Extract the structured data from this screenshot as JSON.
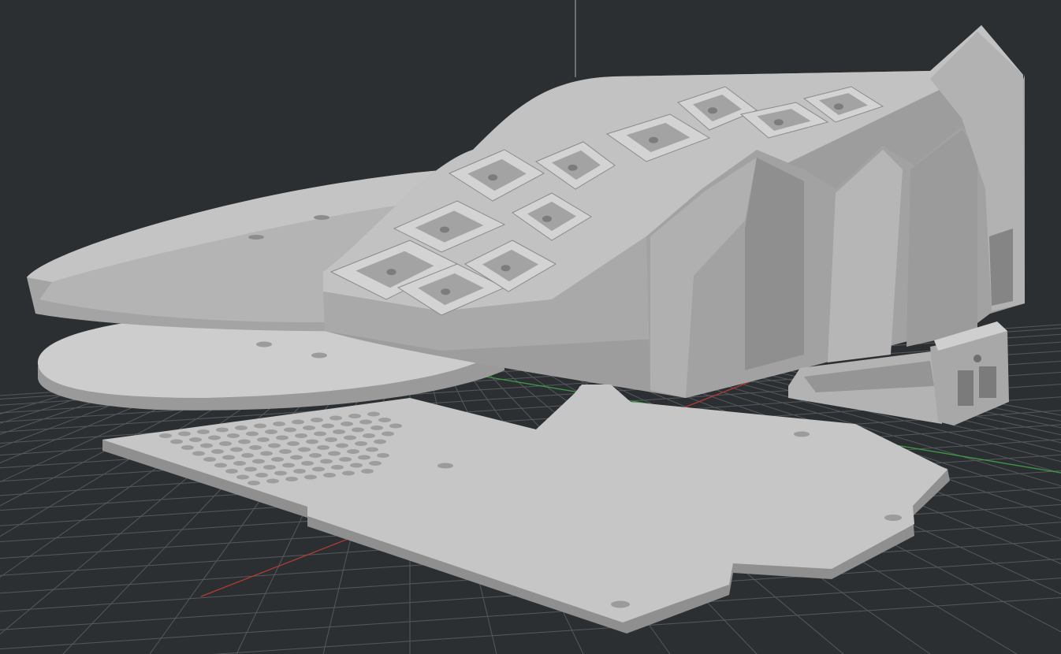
{
  "viewport": {
    "background_color": "#2c2f32",
    "grid_color": "#54595d",
    "x_axis_color": "#b23a36",
    "y_axis_color": "#3c9a44",
    "z_axis_color": "#9a9a9a",
    "model_colors": {
      "top": "#c9c9c9",
      "light": "#b9b9b9",
      "mid": "#a7a7a7",
      "dark": "#8e8e8e",
      "shadow": "#767676",
      "hole": "#9b9b9b"
    },
    "objects": [
      "keyboard-case-body",
      "thumb-cluster-walls",
      "wrist-rest-tray",
      "wrist-rest-base-plate",
      "bottom-plate",
      "controller-holder"
    ]
  }
}
